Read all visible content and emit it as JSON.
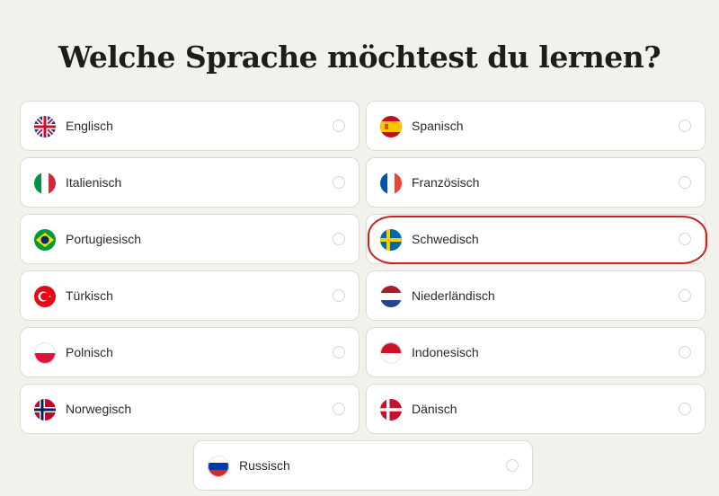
{
  "page": {
    "title": "Welche Sprache möchtest du lernen?"
  },
  "languages": [
    {
      "label": "Englisch",
      "flag_icon": "uk-flag-icon"
    },
    {
      "label": "Spanisch",
      "flag_icon": "spain-flag-icon"
    },
    {
      "label": "Italienisch",
      "flag_icon": "italy-flag-icon"
    },
    {
      "label": "Französisch",
      "flag_icon": "france-flag-icon"
    },
    {
      "label": "Portugiesisch",
      "flag_icon": "brazil-flag-icon"
    },
    {
      "label": "Schwedisch",
      "flag_icon": "sweden-flag-icon",
      "highlighted": true
    },
    {
      "label": "Türkisch",
      "flag_icon": "turkey-flag-icon"
    },
    {
      "label": "Niederländisch",
      "flag_icon": "netherlands-flag-icon"
    },
    {
      "label": "Polnisch",
      "flag_icon": "poland-flag-icon"
    },
    {
      "label": "Indonesisch",
      "flag_icon": "indonesia-flag-icon"
    },
    {
      "label": "Norwegisch",
      "flag_icon": "norway-flag-icon"
    },
    {
      "label": "Dänisch",
      "flag_icon": "denmark-flag-icon"
    },
    {
      "label": "Russisch",
      "flag_icon": "russia-flag-icon"
    }
  ],
  "colors": {
    "background": "#f3f1ec",
    "card": "#ffffff",
    "card_border": "#dedbd4",
    "highlight": "#d11e1e"
  }
}
